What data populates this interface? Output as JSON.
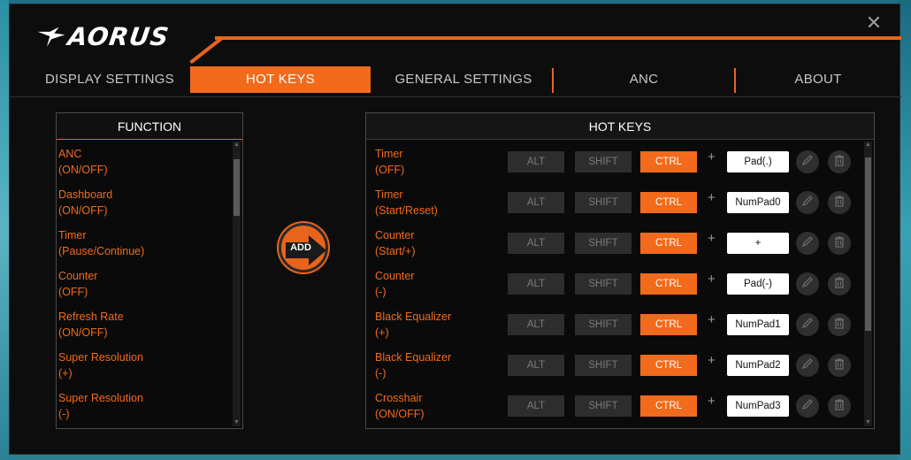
{
  "app": {
    "brand": "AORUS",
    "close_glyph": "✕"
  },
  "tabs": [
    {
      "label": "DISPLAY SETTINGS",
      "active": false
    },
    {
      "label": "HOT KEYS",
      "active": true
    },
    {
      "label": "GENERAL SETTINGS",
      "active": false
    },
    {
      "label": "ANC",
      "active": false
    },
    {
      "label": "ABOUT",
      "active": false
    }
  ],
  "function_panel": {
    "header": "FUNCTION",
    "items": [
      {
        "line1": "ANC",
        "line2": "(ON/OFF)"
      },
      {
        "line1": "Dashboard",
        "line2": "(ON/OFF)"
      },
      {
        "line1": "Timer",
        "line2": "(Pause/Continue)"
      },
      {
        "line1": "Counter",
        "line2": "(OFF)"
      },
      {
        "line1": "Refresh Rate",
        "line2": "(ON/OFF)"
      },
      {
        "line1": "Super Resolution",
        "line2": "(+)"
      },
      {
        "line1": "Super Resolution",
        "line2": "(-)"
      }
    ]
  },
  "add_button": {
    "label": "ADD"
  },
  "hotkeys_panel": {
    "header": "HOT KEYS",
    "modifier_labels": {
      "alt": "ALT",
      "shift": "SHIFT",
      "ctrl": "CTRL"
    },
    "plus": "+",
    "rows": [
      {
        "line1": "Timer",
        "line2": "(OFF)",
        "alt": false,
        "shift": false,
        "ctrl": true,
        "key": "Pad(.)"
      },
      {
        "line1": "Timer",
        "line2": "(Start/Reset)",
        "alt": false,
        "shift": false,
        "ctrl": true,
        "key": "NumPad0"
      },
      {
        "line1": "Counter",
        "line2": "(Start/+)",
        "alt": false,
        "shift": false,
        "ctrl": true,
        "key": "+"
      },
      {
        "line1": "Counter",
        "line2": "(-)",
        "alt": false,
        "shift": false,
        "ctrl": true,
        "key": "Pad(-)"
      },
      {
        "line1": "Black Equalizer",
        "line2": "(+)",
        "alt": false,
        "shift": false,
        "ctrl": true,
        "key": "NumPad1"
      },
      {
        "line1": "Black Equalizer",
        "line2": "(-)",
        "alt": false,
        "shift": false,
        "ctrl": true,
        "key": "NumPad2"
      },
      {
        "line1": "Crosshair",
        "line2": "(ON/OFF)",
        "alt": false,
        "shift": false,
        "ctrl": true,
        "key": "NumPad3"
      }
    ]
  },
  "colors": {
    "accent": "#f26a1b",
    "window_bg": "#0d0d0d",
    "inactive_key": "#2d2d2d"
  },
  "icons": {
    "edit": "pencil-icon",
    "delete": "trash-icon",
    "add": "arrow-right-icon",
    "logo": "aorus-eagle-icon"
  }
}
